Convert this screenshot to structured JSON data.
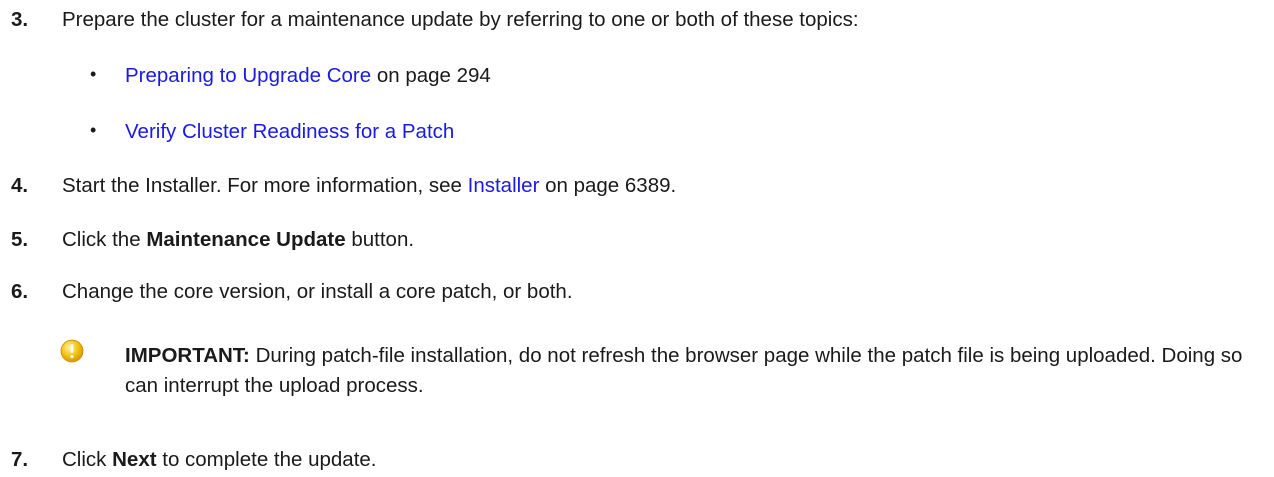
{
  "steps": {
    "s3": {
      "number": "3.",
      "text": "Prepare the cluster for a maintenance update by referring to one or both of these topics:",
      "bullets": [
        {
          "marker": "•",
          "link": "Preparing to Upgrade Core",
          "suffix": " on page 294"
        },
        {
          "marker": "•",
          "link": "Verify Cluster Readiness for a Patch",
          "suffix": ""
        }
      ]
    },
    "s4": {
      "number": "4.",
      "text_before": "Start the Installer. For more information, see ",
      "link": "Installer",
      "text_after": " on page 6389."
    },
    "s5": {
      "number": "5.",
      "text_before": "Click the ",
      "bold": "Maintenance Update",
      "text_after": " button."
    },
    "s6": {
      "number": "6.",
      "text": "Change the core version, or install a core patch, or both.",
      "note": {
        "icon": "important-warning-icon",
        "label": "IMPORTANT:",
        "text": " During patch-file installation, do not refresh the browser page while the patch file is being uploaded. Doing so can interrupt the upload process."
      }
    },
    "s7": {
      "number": "7.",
      "text_before": "Click ",
      "bold": "Next",
      "text_after": " to complete the update."
    }
  },
  "colors": {
    "link": "#1a1ae6",
    "text": "#1a1a1a",
    "important_icon": "#f5c518"
  }
}
